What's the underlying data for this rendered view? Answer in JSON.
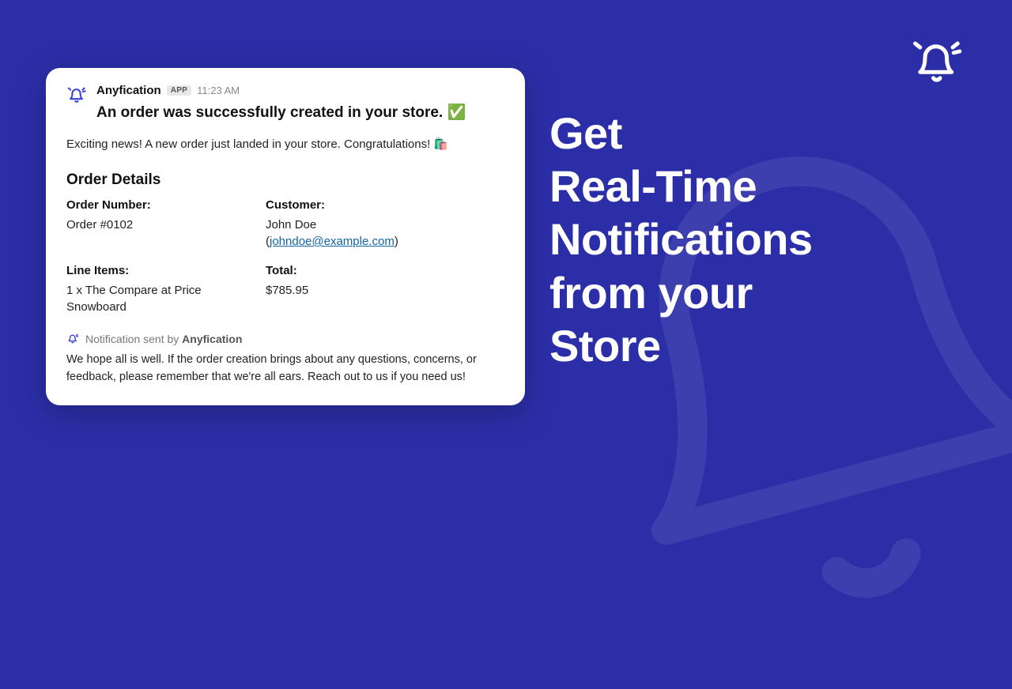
{
  "headline": "Get\nReal-Time Notifications from your Store",
  "card": {
    "app_name": "Anyfication",
    "app_badge": "APP",
    "timestamp": "11:23 AM",
    "title": "An order was successfully created in your store. ✅",
    "intro": "Exciting news! A new order just landed in your store. Congratulations! 🛍️",
    "section_title": "Order Details",
    "labels": {
      "order_number": "Order Number:",
      "customer": "Customer:",
      "line_items": "Line Items:",
      "total": "Total:"
    },
    "values": {
      "order_number": "Order #0102",
      "customer_name": "John Doe",
      "customer_email": "johndoe@example.com",
      "line_items": "1 x The Compare at Price Snowboard",
      "total": "$785.95"
    },
    "footer_prefix": "Notification sent by ",
    "footer_brand": "Anyfication",
    "footer_text": "We hope all is well. If the order creation brings about any questions, concerns, or feedback, please remember that we're all ears. Reach out to us if you need us!"
  }
}
